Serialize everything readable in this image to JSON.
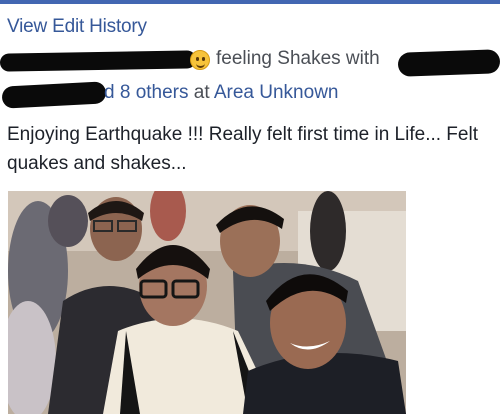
{
  "header": {
    "edit_history_label": "View Edit History"
  },
  "status": {
    "feeling_prefix": "feeling ",
    "feeling_value": "Shakes",
    "with_word": " with",
    "others_count_text": "d 8 others",
    "at_word": " at ",
    "location": "Area Unknown"
  },
  "post": {
    "text": "Enjoying Earthquake !!! Really felt first time in Life... Felt quakes and shakes..."
  },
  "icons": {
    "feeling_emoji": "smile-emoji-icon"
  }
}
